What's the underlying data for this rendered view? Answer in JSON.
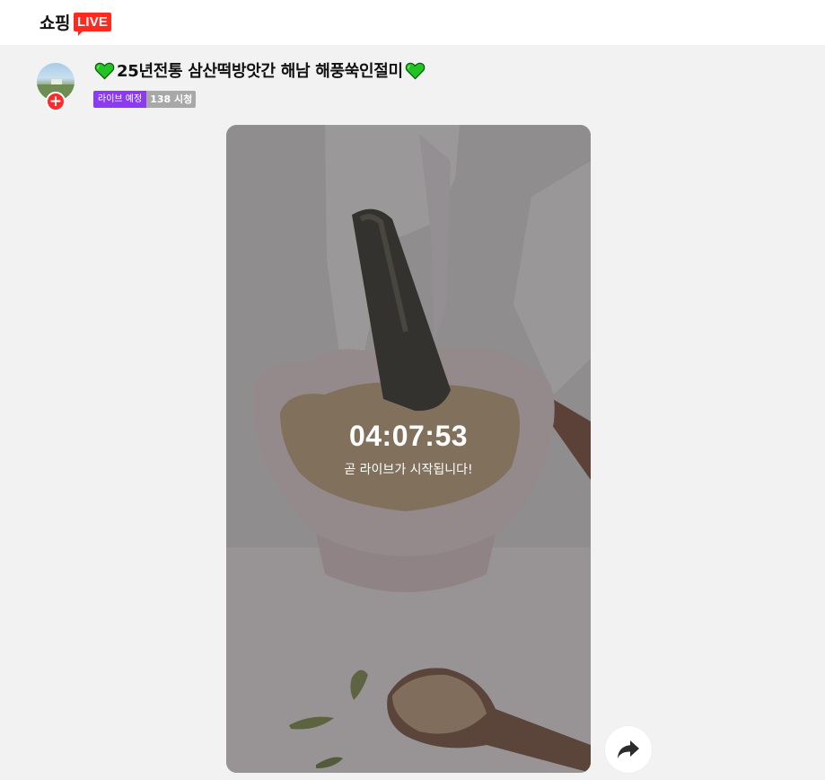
{
  "header": {
    "logo_text": "쇼핑",
    "logo_badge": "LIVE"
  },
  "broadcast": {
    "title": "25년전통 삼산떡방앗간 해남 해풍쑥인절미",
    "status_badge": "라이브 예정",
    "view_count": "138 시청"
  },
  "player": {
    "countdown": "04:07:53",
    "countdown_message": "곧 라이브가 시작됩니다!"
  },
  "icons": {
    "title_decoration": "green-heart-icon",
    "follow": "plus-icon",
    "share": "share-arrow-icon"
  },
  "colors": {
    "live_red": "#ff2a1f",
    "status_purple": "#8b3cf0",
    "count_gray": "#a8a8a8",
    "heart_green": "#22c322"
  }
}
